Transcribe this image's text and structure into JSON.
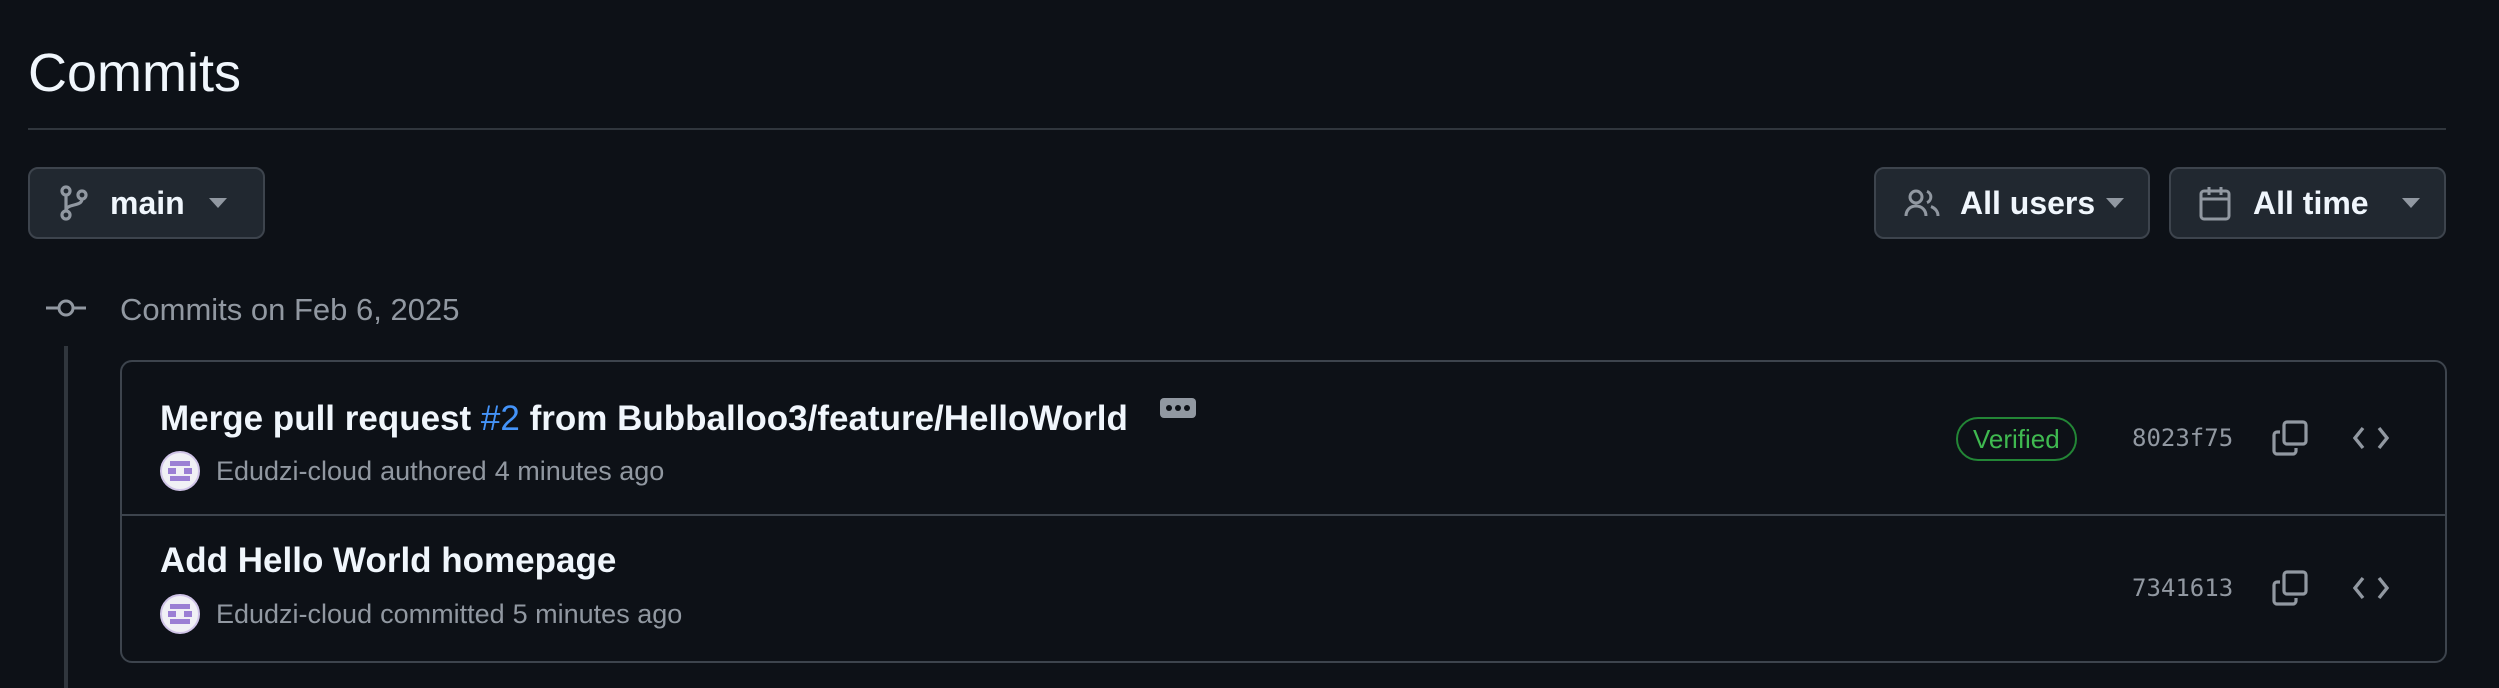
{
  "page": {
    "title": "Commits"
  },
  "filters": {
    "branch": {
      "label": "main",
      "icon": "git-branch-icon"
    },
    "users": {
      "label": "All users",
      "icon": "people-icon"
    },
    "time": {
      "label": "All time",
      "icon": "calendar-icon"
    }
  },
  "timeline": {
    "group_heading": "Commits on Feb 6, 2025"
  },
  "commits": [
    {
      "title_prefix": "Merge pull request ",
      "pr_link": "#2",
      "title_suffix": " from Bubballoo3/feature/HelloWorld",
      "author": "Edudzi-cloud",
      "verb": "authored",
      "time_ago": "4 minutes ago",
      "badge": "Verified",
      "sha": "8023f75"
    },
    {
      "title": "Add Hello World homepage",
      "author": "Edudzi-cloud",
      "verb": "committed",
      "time_ago": "5 minutes ago",
      "sha": "7341613"
    }
  ],
  "colors": {
    "background": "#0d1117",
    "border": "#3d444d",
    "link": "#4493f8",
    "verified": "#3fb950",
    "muted": "#9198a1"
  }
}
